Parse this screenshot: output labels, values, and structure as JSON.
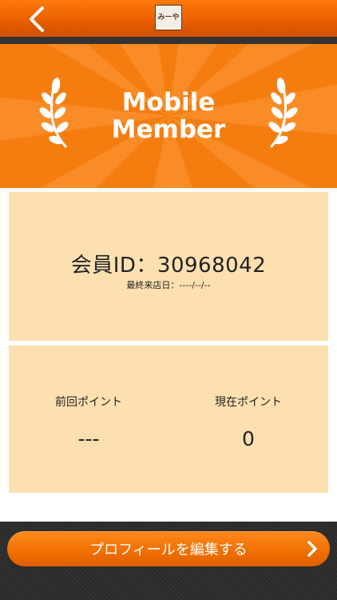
{
  "header": {
    "logo_text": "みーや",
    "colors": {
      "accent": "#f57d0f",
      "strip": "#333333"
    }
  },
  "banner": {
    "title_line1": "Mobile",
    "title_line2": "Member"
  },
  "member_card": {
    "member_id_label": "会員ID：30968042",
    "last_visit_label": "最終来店日：----/--/--"
  },
  "points_card": {
    "previous_label": "前回ポイント",
    "previous_value": "---",
    "current_label": "現在ポイント",
    "current_value": "0"
  },
  "footer": {
    "edit_profile_label": "プロフィールを編集する"
  },
  "icons": [
    "back-chevron-icon",
    "laurel-icon",
    "chevron-right-icon"
  ]
}
